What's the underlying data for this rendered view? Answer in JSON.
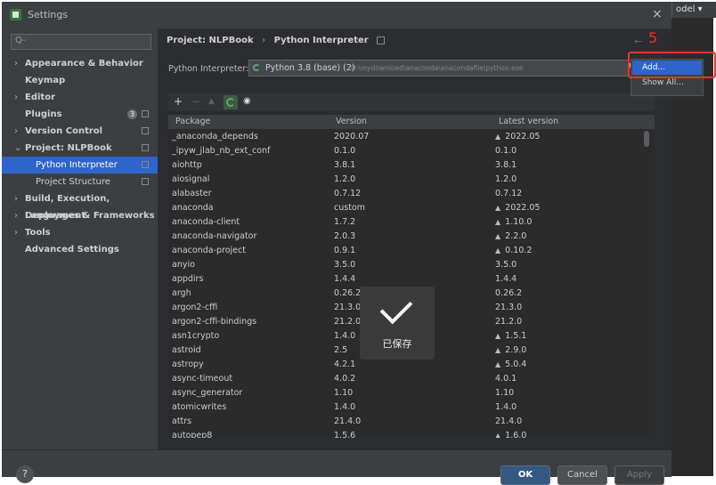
{
  "window": {
    "title": "Settings",
    "close_icon": "×",
    "bg_tab_label": "odel ▾"
  },
  "sidebar": {
    "search_placeholder": "Q-",
    "items": [
      {
        "label": "Appearance & Behavior",
        "arrow": "›"
      },
      {
        "label": "Keymap"
      },
      {
        "label": "Editor",
        "arrow": "›"
      },
      {
        "label": "Plugins",
        "badge": "3"
      },
      {
        "label": "Version Control",
        "arrow": "›"
      },
      {
        "label": "Project: NLPBook",
        "arrow": "⌄"
      },
      {
        "label": "Python Interpreter"
      },
      {
        "label": "Project Structure"
      },
      {
        "label": "Build, Execution, Deployment",
        "arrow": "›"
      },
      {
        "label": "Languages & Frameworks",
        "arrow": "›"
      },
      {
        "label": "Tools",
        "arrow": "›"
      },
      {
        "label": "Advanced Settings"
      }
    ]
  },
  "breadcrumb": {
    "project": "Project: NLPBook",
    "separator": "›",
    "page": "Python Interpreter"
  },
  "nav": {
    "back_arrow": "←"
  },
  "annotation": {
    "step_label": "5",
    "color": "#e8362c"
  },
  "interpreter": {
    "label": "Python Interpreter:",
    "name": "Python 3.8 (base) (2)",
    "path": "D:\\mydownload\\anaconda\\anacondafile\\python.exe"
  },
  "dropdown_menu": {
    "add_label": "Add...",
    "show_all_label": "Show All..."
  },
  "toolbar": {
    "add": "+",
    "remove": "−",
    "upgrade": "▲",
    "eye": "◉"
  },
  "table": {
    "columns": [
      "Package",
      "Version",
      "Latest version"
    ],
    "rows": [
      {
        "package": "_anaconda_depends",
        "version": "2020.07",
        "latest": "2022.05",
        "upgrade": true
      },
      {
        "package": "_ipyw_jlab_nb_ext_conf",
        "version": "0.1.0",
        "latest": "0.1.0",
        "upgrade": false
      },
      {
        "package": "aiohttp",
        "version": "3.8.1",
        "latest": "3.8.1",
        "upgrade": false
      },
      {
        "package": "aiosignal",
        "version": "1.2.0",
        "latest": "1.2.0",
        "upgrade": false
      },
      {
        "package": "alabaster",
        "version": "0.7.12",
        "latest": "0.7.12",
        "upgrade": false
      },
      {
        "package": "anaconda",
        "version": "custom",
        "latest": "2022.05",
        "upgrade": true
      },
      {
        "package": "anaconda-client",
        "version": "1.7.2",
        "latest": "1.10.0",
        "upgrade": true
      },
      {
        "package": "anaconda-navigator",
        "version": "2.0.3",
        "latest": "2.2.0",
        "upgrade": true
      },
      {
        "package": "anaconda-project",
        "version": "0.9.1",
        "latest": "0.10.2",
        "upgrade": true
      },
      {
        "package": "anyio",
        "version": "3.5.0",
        "latest": "3.5.0",
        "upgrade": false
      },
      {
        "package": "appdirs",
        "version": "1.4.4",
        "latest": "1.4.4",
        "upgrade": false
      },
      {
        "package": "argh",
        "version": "0.26.2",
        "latest": "0.26.2",
        "upgrade": false
      },
      {
        "package": "argon2-cffi",
        "version": "21.3.0",
        "latest": "21.3.0",
        "upgrade": false
      },
      {
        "package": "argon2-cffi-bindings",
        "version": "21.2.0",
        "latest": "21.2.0",
        "upgrade": false
      },
      {
        "package": "asn1crypto",
        "version": "1.4.0",
        "latest": "1.5.1",
        "upgrade": true
      },
      {
        "package": "astroid",
        "version": "2.5",
        "latest": "2.9.0",
        "upgrade": true
      },
      {
        "package": "astropy",
        "version": "4.2.1",
        "latest": "5.0.4",
        "upgrade": true
      },
      {
        "package": "async-timeout",
        "version": "4.0.2",
        "latest": "4.0.1",
        "upgrade": false
      },
      {
        "package": "async_generator",
        "version": "1.10",
        "latest": "1.10",
        "upgrade": false
      },
      {
        "package": "atomicwrites",
        "version": "1.4.0",
        "latest": "1.4.0",
        "upgrade": false
      },
      {
        "package": "attrs",
        "version": "21.4.0",
        "latest": "21.4.0",
        "upgrade": false
      },
      {
        "package": "autopep8",
        "version": "1.5.6",
        "latest": "1.6.0",
        "upgrade": true
      }
    ]
  },
  "toast": {
    "text": "已保存"
  },
  "footer": {
    "help": "?",
    "ok": "OK",
    "cancel": "Cancel",
    "apply": "Apply"
  }
}
